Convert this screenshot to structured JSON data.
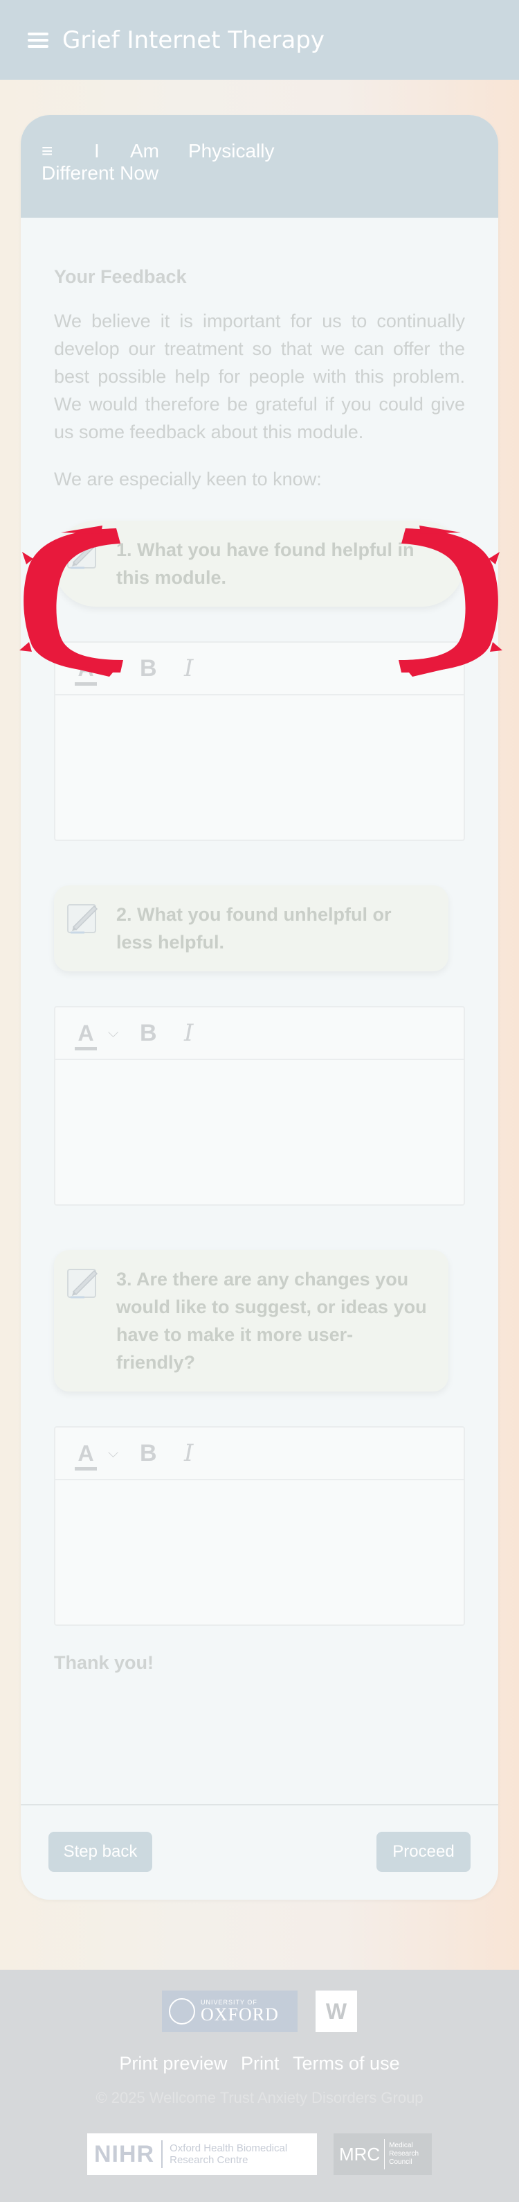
{
  "app": {
    "title": "Grief Internet Therapy",
    "menu_icon": "hamburger-icon"
  },
  "module": {
    "title_words": [
      "I",
      "Am",
      "Physically"
    ],
    "title_line2": "Different Now"
  },
  "feedback": {
    "heading": "Your Feedback",
    "intro": "We believe it is important for us to continually develop our treatment so that we can offer the best possible help for people with this problem. We would therefore be grateful if you could give us some feedback about this module.",
    "keen": "We are especially keen to know:",
    "questions": [
      "1. What you have found helpful in this module.",
      "2. What you found unhelpful or less helpful.",
      "3. Are there are any changes you would like to suggest, or ideas you have to make it more user-friendly?"
    ],
    "editor_toolbar": {
      "color": "A",
      "bold": "B",
      "italic": "I"
    },
    "thanks": "Thank you!"
  },
  "nav": {
    "back": "Step back",
    "next": "Proceed"
  },
  "footer": {
    "oxford_small": "UNIVERSITY OF",
    "oxford_big": "OXFORD",
    "w_logo": "W",
    "links": [
      "Print preview",
      "Print",
      "Terms of use"
    ],
    "copyright": "© 2025 Wellcome Trust Anxiety Disorders Group",
    "nihr_big": "NIHR",
    "nihr_small_1": "Oxford Health Biomedical",
    "nihr_small_2": "Research Centre",
    "mrc_big": "MRC",
    "mrc_small": [
      "Medical",
      "Research",
      "Council"
    ]
  },
  "colors": {
    "accent": "#ccd9df",
    "highlight": "#e8193c"
  }
}
